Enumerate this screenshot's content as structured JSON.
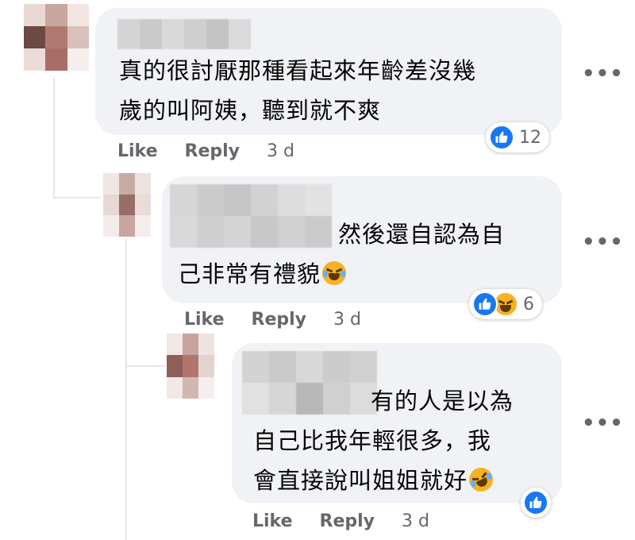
{
  "comments": [
    {
      "text_lines": [
        "真的很討厭那種看起來年齡差沒幾",
        "歲的叫阿姨，聽到就不爽"
      ],
      "reaction": {
        "icons": [
          "like-icon"
        ],
        "count": "12"
      },
      "actions": {
        "like": "Like",
        "reply": "Reply",
        "time": "3 d"
      },
      "more": "•••"
    },
    {
      "text_lines": [
        "然後還自認為自",
        "己非常有禮貌"
      ],
      "emoji": "face-with-tears-of-joy",
      "reaction": {
        "icons": [
          "like-icon",
          "haha-icon"
        ],
        "count": "6"
      },
      "actions": {
        "like": "Like",
        "reply": "Reply",
        "time": "3 d"
      },
      "more": "•••"
    },
    {
      "text_lines": [
        "有的人是以為",
        "自己比我年輕很多，我",
        "會直接說叫姐姐就好"
      ],
      "emoji": "rolling-on-the-floor-laughing",
      "reaction": {
        "icons": [
          "like-icon"
        ]
      },
      "actions": {
        "like": "Like",
        "reply": "Reply",
        "time": "3 d"
      },
      "more": "•••"
    }
  ],
  "colors": {
    "bubble": "#f0f2f5",
    "meta_text": "#65676b",
    "like_blue": "#1877f2",
    "haha_yellow": "#f7b125"
  }
}
